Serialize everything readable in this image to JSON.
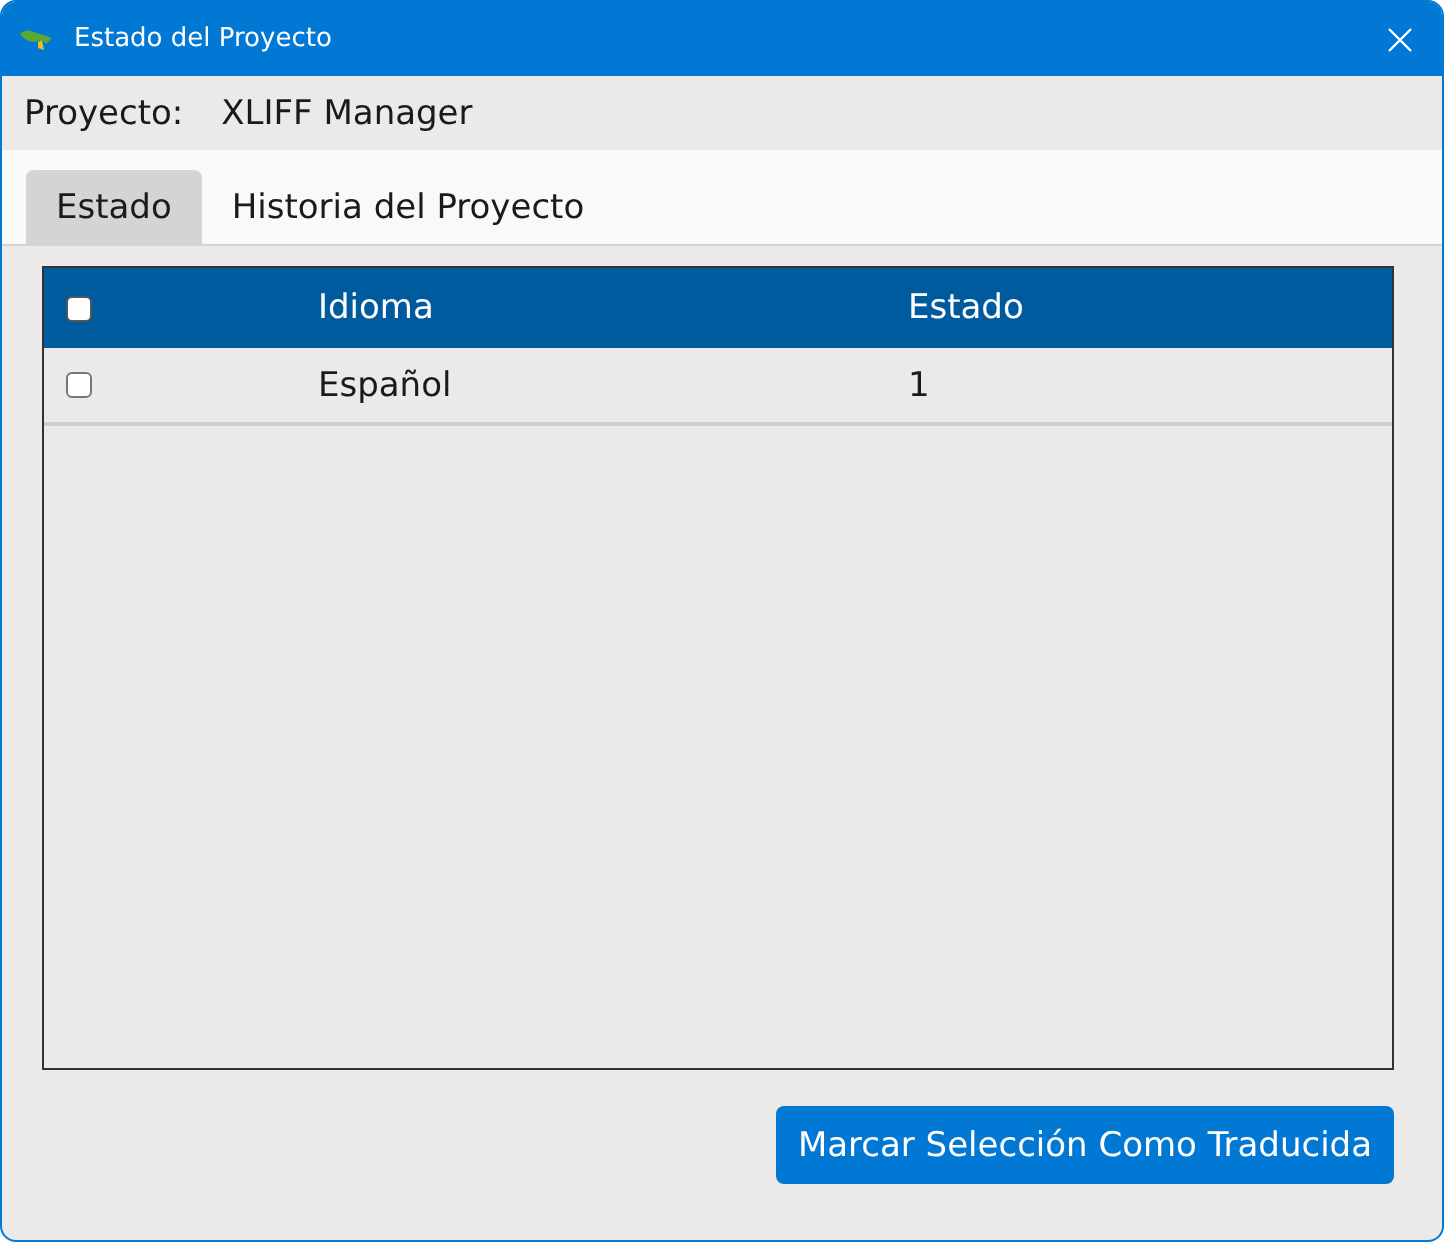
{
  "window": {
    "title": "Estado del Proyecto"
  },
  "project": {
    "label": "Proyecto:",
    "value": "XLIFF Manager"
  },
  "tabs": [
    {
      "label": "Estado",
      "selected": true
    },
    {
      "label": "Historia del Proyecto",
      "selected": false
    }
  ],
  "table": {
    "select_all": {
      "checked": false
    },
    "columns": [
      "Idioma",
      "Estado"
    ],
    "rows": [
      {
        "checked": false,
        "cells": [
          "Español",
          "1"
        ]
      }
    ]
  },
  "buttons": [
    {
      "label": "Marcar Selección Como Traducida"
    }
  ]
}
